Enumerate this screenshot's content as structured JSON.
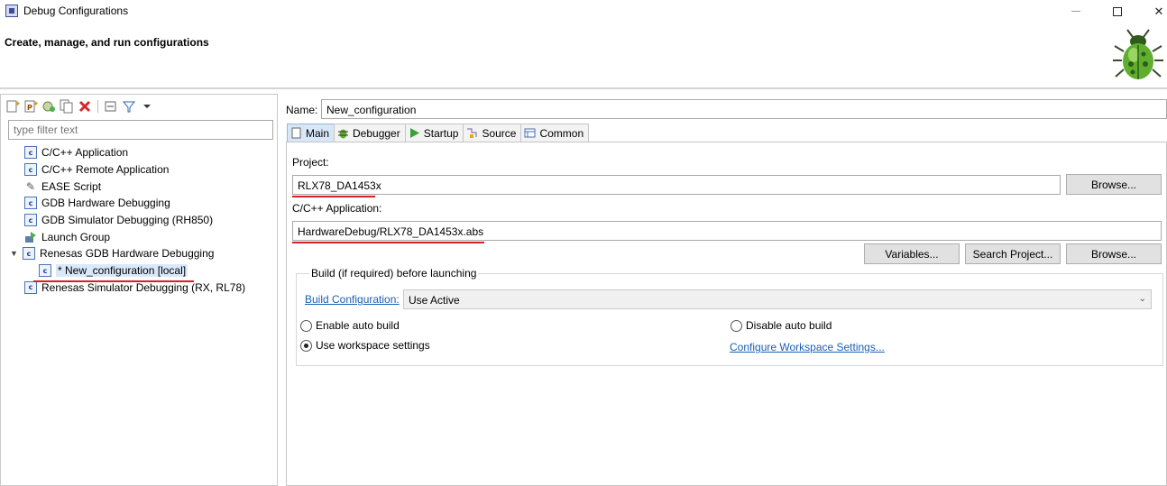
{
  "window": {
    "title": "Debug Configurations"
  },
  "banner": {
    "title": "Create, manage, and run configurations"
  },
  "left": {
    "filter_placeholder": "type filter text",
    "tree": [
      {
        "label": "C/C++ Application",
        "icon": "c-config-icon"
      },
      {
        "label": "C/C++ Remote Application",
        "icon": "c-config-icon"
      },
      {
        "label": "EASE Script",
        "icon": "script-icon"
      },
      {
        "label": "GDB Hardware Debugging",
        "icon": "c-config-icon"
      },
      {
        "label": "GDB Simulator Debugging (RH850)",
        "icon": "c-config-icon"
      },
      {
        "label": "Launch Group",
        "icon": "launch-group-icon"
      },
      {
        "label": "Renesas GDB Hardware Debugging",
        "icon": "c-config-icon",
        "expanded": true
      },
      {
        "label": "* New_configuration [local]",
        "icon": "c-config-icon",
        "selected": true
      },
      {
        "label": "Renesas Simulator Debugging (RX, RL78)",
        "icon": "c-config-icon"
      }
    ]
  },
  "right": {
    "name_label": "Name:",
    "name_value": "New_configuration",
    "tabs": [
      "Main",
      "Debugger",
      "Startup",
      "Source",
      "Common"
    ],
    "project_label": "Project:",
    "project_value": "RLX78_DA1453x",
    "browse_label": "Browse...",
    "app_label": "C/C++ Application:",
    "app_value": "HardwareDebug/RLX78_DA1453x.abs",
    "variables_label": "Variables...",
    "search_project_label": "Search Project...",
    "build_group_title": "Build (if required) before launching",
    "build_config_link": "Build Configuration:",
    "build_config_value": "Use Active",
    "enable_auto_build": "Enable auto build",
    "disable_auto_build": "Disable auto build",
    "use_workspace_settings": "Use workspace settings",
    "configure_workspace_link": "Configure Workspace Settings..."
  },
  "colors": {
    "accent_red": "#d62023",
    "link_blue": "#1a5fb4",
    "tab_active": "#d8e7f7"
  }
}
